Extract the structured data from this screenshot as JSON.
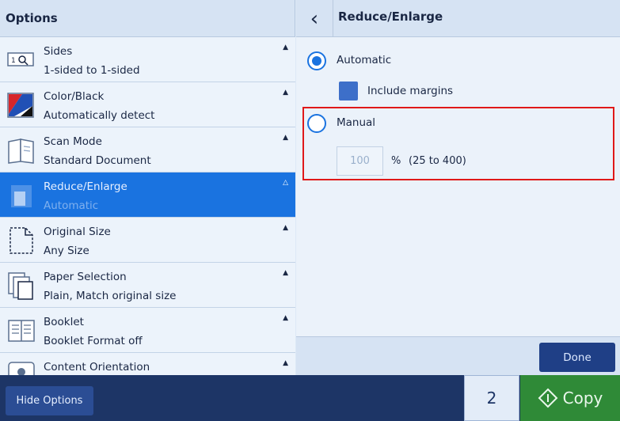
{
  "options_panel": {
    "title": "Options",
    "items": [
      {
        "title": "Sides",
        "value": "1-sided to 1-sided",
        "icon": "sides-icon"
      },
      {
        "title": "Color/Black",
        "value": "Automatically detect",
        "icon": "color-black-icon"
      },
      {
        "title": "Scan Mode",
        "value": "Standard Document",
        "icon": "scan-mode-icon"
      },
      {
        "title": "Reduce/Enlarge",
        "value": "Automatic",
        "icon": "reduce-enlarge-icon",
        "selected": true
      },
      {
        "title": "Original Size",
        "value": "Any Size",
        "icon": "original-size-icon"
      },
      {
        "title": "Paper Selection",
        "value": "Plain, Match original size",
        "icon": "paper-selection-icon"
      },
      {
        "title": "Booklet",
        "value": "Booklet Format off",
        "icon": "booklet-icon"
      },
      {
        "title": "Content Orientation",
        "value": "",
        "icon": "content-orientation-icon"
      }
    ]
  },
  "detail_panel": {
    "title": "Reduce/Enlarge",
    "automatic_label": "Automatic",
    "include_margins_label": "Include margins",
    "manual_label": "Manual",
    "manual_value": "100",
    "percent_label": "%",
    "range_label": "(25 to 400)",
    "done_label": "Done"
  },
  "bottom_bar": {
    "hide_options_label": "Hide Options",
    "copies": "2",
    "copy_label": "Copy"
  },
  "colors": {
    "accent": "#1a73e0",
    "highlight_box": "#e01919",
    "copy_button": "#2f8a37",
    "bottom_bar": "#1d3566"
  }
}
